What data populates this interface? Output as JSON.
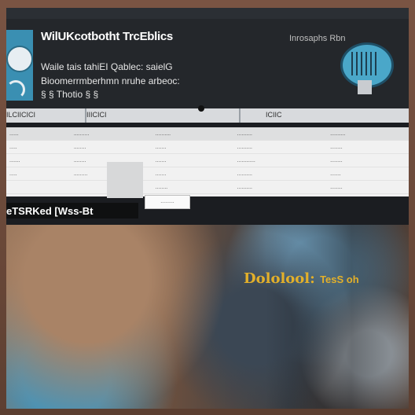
{
  "banner": {
    "title": "WilUKcotbotht TrcEblics",
    "line1": "Waile tais tahiEI Qablec: saielG",
    "line2": "Bioomerrmberhmn nruhe arbeoc:",
    "line3": "§ § Thotio       §  §",
    "right_label": "Inrosaphs Rbn"
  },
  "toolbar": {
    "items": [
      "ILCIICICI",
      "IIICICI",
      "ICIIC"
    ]
  },
  "table": {
    "header": [
      "......",
      "..........",
      "..........",
      "..........",
      ".........."
    ],
    "rows": [
      [
        ".....",
        "........",
        ".......",
        "..........",
        "........"
      ],
      [
        ".......",
        "........",
        ".......",
        "............",
        "........"
      ],
      [
        ".....",
        ".........",
        ".......",
        "..........",
        "......."
      ],
      [
        "",
        "",
        "........",
        "..........",
        "........"
      ],
      [
        "",
        "",
        ".........",
        "",
        ""
      ]
    ],
    "button": "........."
  },
  "caption": {
    "text": "eTSRKed [Wss-Bt"
  },
  "photo": {
    "overlay_main": "Dololool:",
    "overlay_small": "TesS oh"
  },
  "colors": {
    "banner_bg": "#24272b",
    "accent_blue": "#3a8fb2",
    "overlay_gold": "#e3b02a"
  }
}
